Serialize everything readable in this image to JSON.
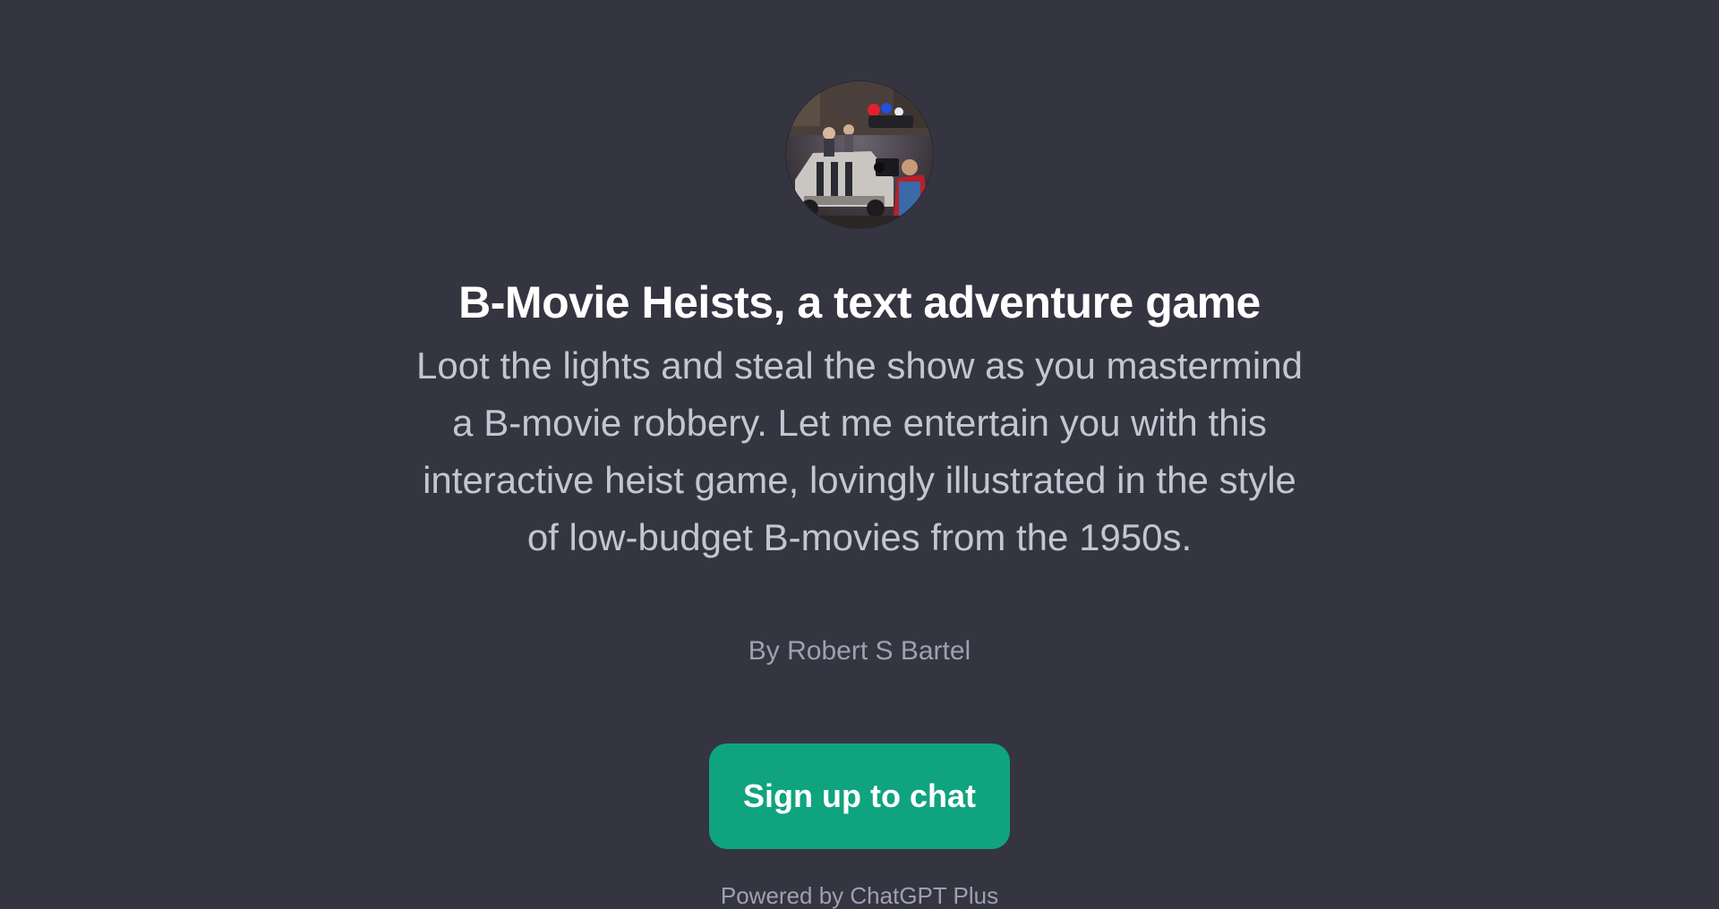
{
  "gpt": {
    "avatar_alt": "B-Movie Heists avatar",
    "title": "B-Movie Heists, a text adventure game",
    "description": "Loot the lights and steal the show as you mastermind a B-movie robbery. Let me entertain you with this interactive heist game, lovingly illustrated in the style of low-budget B-movies from the 1950s.",
    "author": "By Robert S Bartel"
  },
  "actions": {
    "signup_label": "Sign up to chat"
  },
  "footer": {
    "powered_by": "Powered by ChatGPT Plus"
  },
  "colors": {
    "background": "#343541",
    "title": "#ffffff",
    "description": "#c5c5d2",
    "byline": "#a0a0ae",
    "accent": "#10a37f"
  }
}
